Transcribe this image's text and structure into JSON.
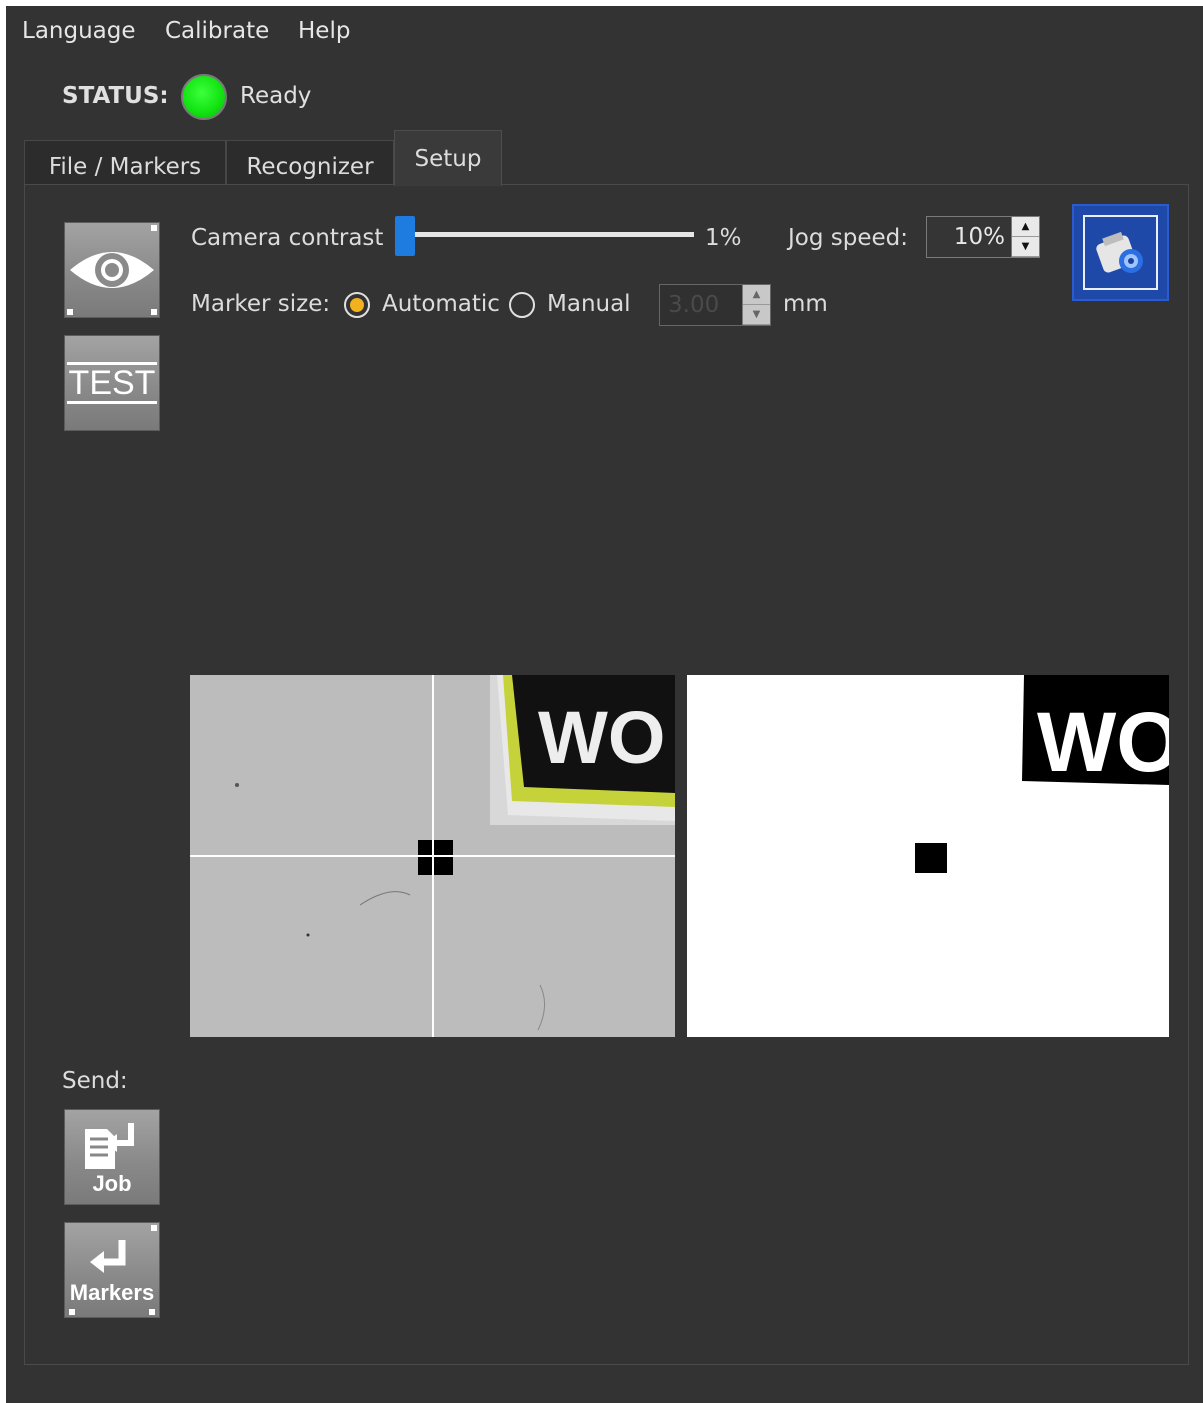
{
  "menu": {
    "items": [
      "Language",
      "Calibrate",
      "Help"
    ]
  },
  "status": {
    "label": "STATUS:",
    "text": "Ready",
    "led_color": "#13e513"
  },
  "tabs": [
    {
      "label": "File / Markers",
      "active": false
    },
    {
      "label": "Recognizer",
      "active": false
    },
    {
      "label": "Setup",
      "active": true
    }
  ],
  "tools": {
    "view_button_icon": "eye-icon",
    "test_button": {
      "label": "TEST"
    }
  },
  "setup": {
    "camera_contrast": {
      "label": "Camera contrast",
      "value": 1,
      "value_text": "1%"
    },
    "jog_speed": {
      "label": "Jog speed:",
      "value": "10%"
    },
    "marker_size": {
      "label": "Marker size:",
      "options": [
        "Automatic",
        "Manual"
      ],
      "selected": "Automatic",
      "value": "3.00",
      "unit": "mm",
      "value_disabled": true
    }
  },
  "camera_button_icon": "camera-icon",
  "camera_views": {
    "left": {
      "type": "grayscale camera feed with crosshair",
      "sign_text": "WO"
    },
    "right": {
      "type": "thresholded binary feed",
      "sign_text": "WO"
    }
  },
  "send": {
    "label": "Send:",
    "job_button": {
      "label": "Job"
    },
    "markers_button": {
      "label": "Markers"
    }
  },
  "colors": {
    "background": "#333333",
    "accent_blue": "#1e7be0",
    "radio_dot": "#f2b21e",
    "camera_button": "#1f49a8"
  }
}
